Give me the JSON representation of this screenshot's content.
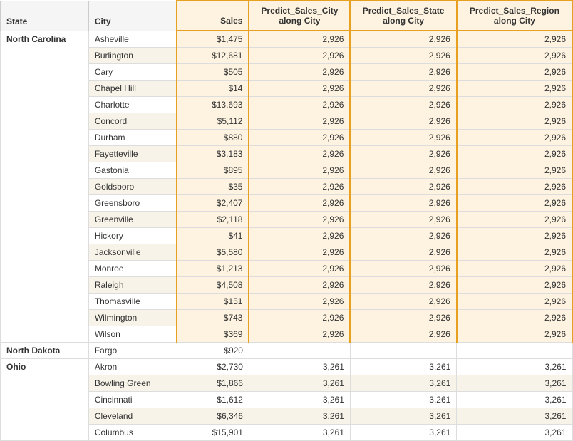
{
  "headers": {
    "state": "State",
    "city": "City",
    "sales": "Sales",
    "predict_city": "Predict_Sales_City along City",
    "predict_state": "Predict_Sales_State along City",
    "predict_region": "Predict_Sales_Region along City"
  },
  "sections": [
    {
      "state": "North Carolina",
      "rows": [
        {
          "city": "Asheville",
          "sales": "$1,475",
          "pc": "2,926",
          "ps": "2,926",
          "pr": "2,926"
        },
        {
          "city": "Burlington",
          "sales": "$12,681",
          "pc": "2,926",
          "ps": "2,926",
          "pr": "2,926"
        },
        {
          "city": "Cary",
          "sales": "$505",
          "pc": "2,926",
          "ps": "2,926",
          "pr": "2,926"
        },
        {
          "city": "Chapel Hill",
          "sales": "$14",
          "pc": "2,926",
          "ps": "2,926",
          "pr": "2,926"
        },
        {
          "city": "Charlotte",
          "sales": "$13,693",
          "pc": "2,926",
          "ps": "2,926",
          "pr": "2,926"
        },
        {
          "city": "Concord",
          "sales": "$5,112",
          "pc": "2,926",
          "ps": "2,926",
          "pr": "2,926"
        },
        {
          "city": "Durham",
          "sales": "$880",
          "pc": "2,926",
          "ps": "2,926",
          "pr": "2,926"
        },
        {
          "city": "Fayetteville",
          "sales": "$3,183",
          "pc": "2,926",
          "ps": "2,926",
          "pr": "2,926"
        },
        {
          "city": "Gastonia",
          "sales": "$895",
          "pc": "2,926",
          "ps": "2,926",
          "pr": "2,926"
        },
        {
          "city": "Goldsboro",
          "sales": "$35",
          "pc": "2,926",
          "ps": "2,926",
          "pr": "2,926"
        },
        {
          "city": "Greensboro",
          "sales": "$2,407",
          "pc": "2,926",
          "ps": "2,926",
          "pr": "2,926"
        },
        {
          "city": "Greenville",
          "sales": "$2,118",
          "pc": "2,926",
          "ps": "2,926",
          "pr": "2,926"
        },
        {
          "city": "Hickory",
          "sales": "$41",
          "pc": "2,926",
          "ps": "2,926",
          "pr": "2,926"
        },
        {
          "city": "Jacksonville",
          "sales": "$5,580",
          "pc": "2,926",
          "ps": "2,926",
          "pr": "2,926"
        },
        {
          "city": "Monroe",
          "sales": "$1,213",
          "pc": "2,926",
          "ps": "2,926",
          "pr": "2,926"
        },
        {
          "city": "Raleigh",
          "sales": "$4,508",
          "pc": "2,926",
          "ps": "2,926",
          "pr": "2,926"
        },
        {
          "city": "Thomasville",
          "sales": "$151",
          "pc": "2,926",
          "ps": "2,926",
          "pr": "2,926"
        },
        {
          "city": "Wilmington",
          "sales": "$743",
          "pc": "2,926",
          "ps": "2,926",
          "pr": "2,926"
        },
        {
          "city": "Wilson",
          "sales": "$369",
          "pc": "2,926",
          "ps": "2,926",
          "pr": "2,926"
        }
      ]
    },
    {
      "state": "North Dakota",
      "rows": [
        {
          "city": "Fargo",
          "sales": "$920",
          "pc": "",
          "ps": "",
          "pr": ""
        }
      ]
    },
    {
      "state": "Ohio",
      "rows": [
        {
          "city": "Akron",
          "sales": "$2,730",
          "pc": "3,261",
          "ps": "3,261",
          "pr": "3,261"
        },
        {
          "city": "Bowling Green",
          "sales": "$1,866",
          "pc": "3,261",
          "ps": "3,261",
          "pr": "3,261"
        },
        {
          "city": "Cincinnati",
          "sales": "$1,612",
          "pc": "3,261",
          "ps": "3,261",
          "pr": "3,261"
        },
        {
          "city": "Cleveland",
          "sales": "$6,346",
          "pc": "3,261",
          "ps": "3,261",
          "pr": "3,261"
        },
        {
          "city": "Columbus",
          "sales": "$15,901",
          "pc": "3,261",
          "ps": "3,261",
          "pr": "3,261"
        }
      ]
    }
  ]
}
